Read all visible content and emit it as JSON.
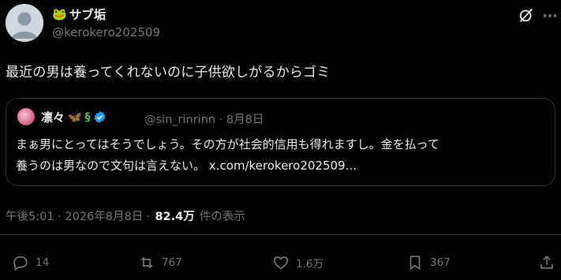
{
  "author": {
    "display_name": "サブ垢",
    "handle": "@kerokero202509"
  },
  "tweet": {
    "text": "最近の男は養ってくれないのに子供欲しがるからゴミ"
  },
  "quote": {
    "name": "凛々",
    "handle_date": "@sin_rinrinn · 8月8日",
    "text_line1": "まぁ男にとってはそうでしょう。その方が社会的信用も得れますし。金を払って",
    "text_line2": "養うのは男なので文句は言えない。",
    "link": "x.com/kerokero202509..."
  },
  "meta": {
    "timestamp": "午後5:01 · 2026年8月8日 ·",
    "views_count": "82.4万",
    "views_label": "件の表示"
  },
  "actions": {
    "replies": "14",
    "reposts": "767",
    "likes": "1.6万",
    "bookmarks": "367"
  },
  "icons": [
    "frog-emoji-icon",
    "grok-icon",
    "more-icon",
    "butterfly-emoji-icon",
    "snake-emoji-icon",
    "verified-badge-icon",
    "reply-icon",
    "repost-icon",
    "like-icon",
    "bookmark-icon",
    "share-icon"
  ],
  "colors": {
    "background": "#000000",
    "text": "#e7e9ea",
    "muted": "#71767b",
    "verified": "#1d9bf0",
    "border": "#2f3336"
  }
}
